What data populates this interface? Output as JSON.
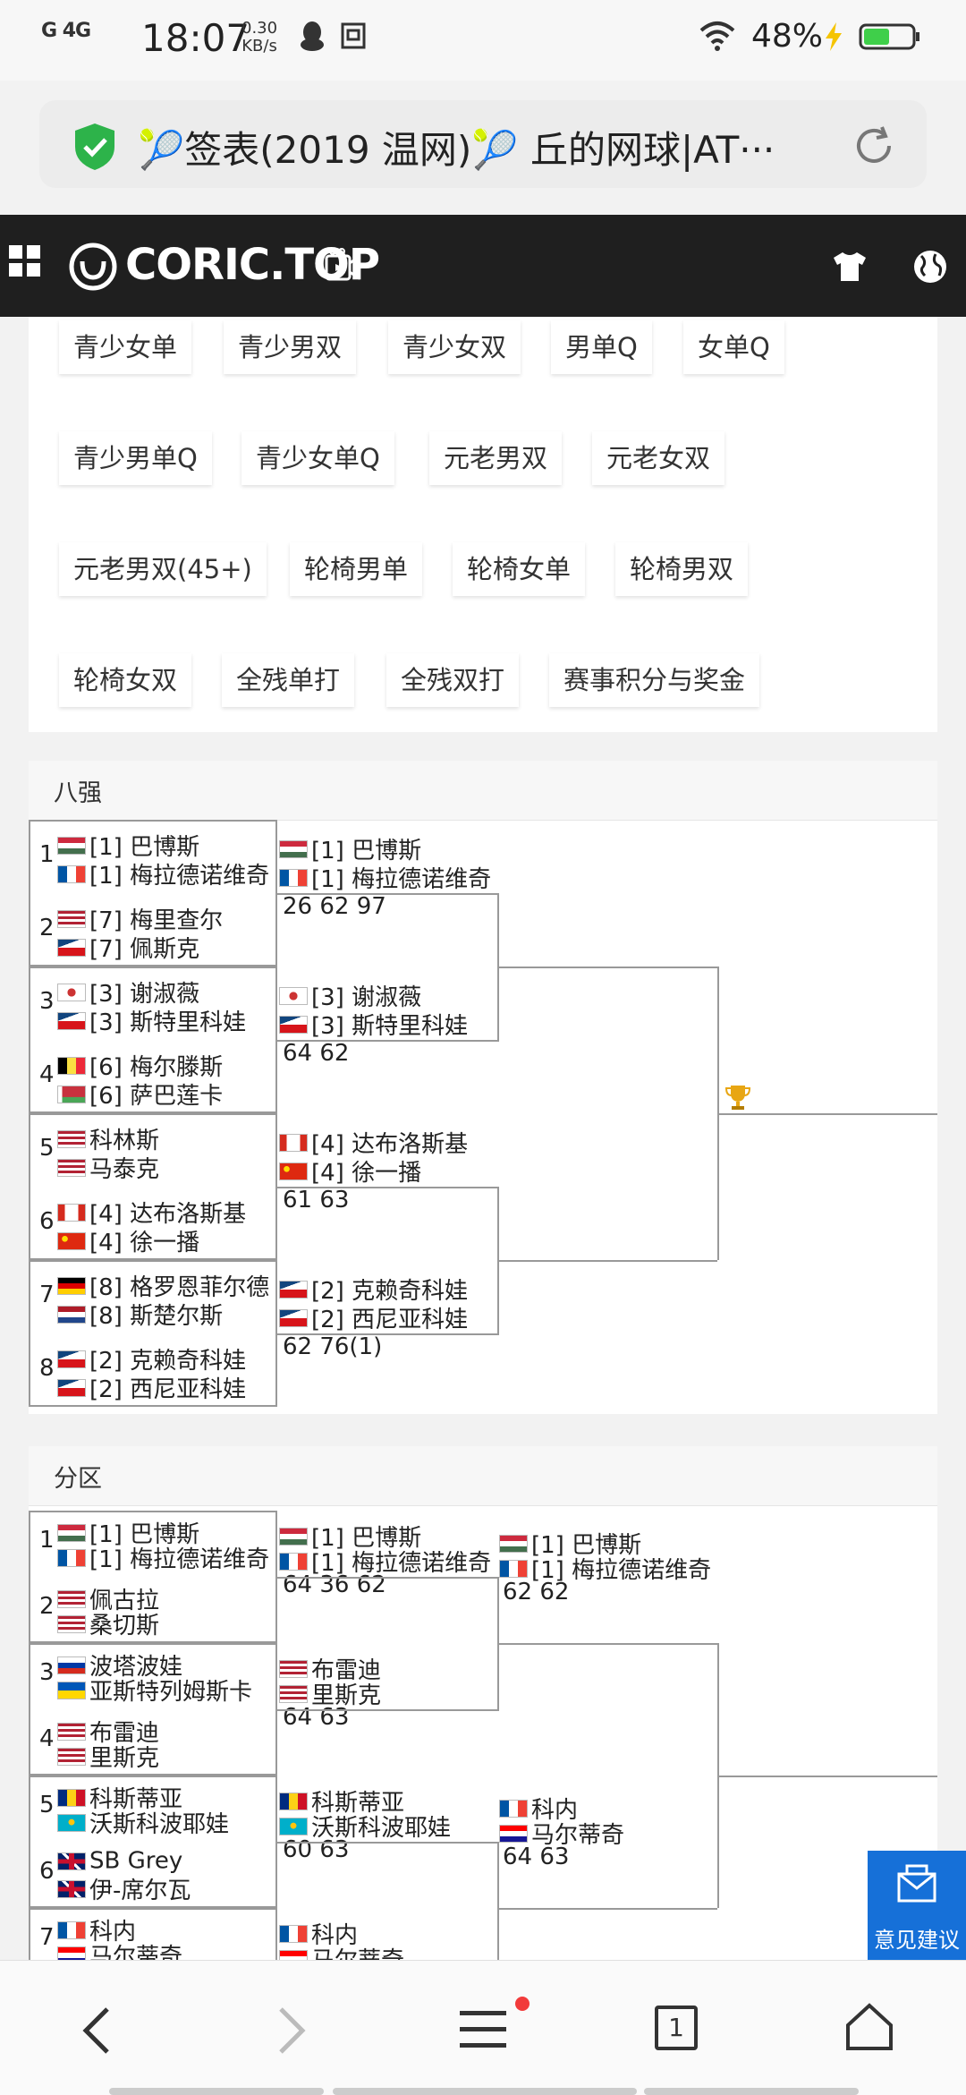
{
  "status_bar": {
    "signal": "G 4G",
    "time": "18:07",
    "speed_value": "0.30",
    "speed_unit": "KB/s",
    "battery": "48%"
  },
  "url_bar": {
    "title": "🎾签表(2019 温网)🎾 丘的网球|AT···"
  },
  "site_header": {
    "logo_text": "CORIC.TOP"
  },
  "categories": [
    "青少女单",
    "青少男双",
    "青少女双",
    "男单Q",
    "女单Q",
    "青少男单Q",
    "青少女单Q",
    "元老男双",
    "元老女双",
    "元老男双(45+)",
    "轮椅男单",
    "轮椅女单",
    "轮椅男双",
    "轮椅女双",
    "全残单打",
    "全残双打",
    "赛事积分与奖金"
  ],
  "quarterfinals": {
    "title": "八强",
    "entries": [
      {
        "num": "1",
        "p1": {
          "flag": "hu",
          "name": "[1] 巴博斯"
        },
        "p2": {
          "flag": "fr",
          "name": "[1] 梅拉德诺维奇"
        }
      },
      {
        "num": "2",
        "p1": {
          "flag": "us",
          "name": "[7] 梅里查尔"
        },
        "p2": {
          "flag": "cz",
          "name": "[7] 佩斯克"
        }
      },
      {
        "num": "3",
        "p1": {
          "flag": "tw",
          "name": "[3] 谢淑薇"
        },
        "p2": {
          "flag": "cz",
          "name": "[3] 斯特里科娃"
        }
      },
      {
        "num": "4",
        "p1": {
          "flag": "be",
          "name": "[6] 梅尔滕斯"
        },
        "p2": {
          "flag": "by",
          "name": "[6] 萨巴莲卡"
        }
      },
      {
        "num": "5",
        "p1": {
          "flag": "us",
          "name": "科林斯"
        },
        "p2": {
          "flag": "us",
          "name": "马泰克"
        }
      },
      {
        "num": "6",
        "p1": {
          "flag": "ca",
          "name": "[4] 达布洛斯基"
        },
        "p2": {
          "flag": "cn",
          "name": "[4] 徐一播"
        }
      },
      {
        "num": "7",
        "p1": {
          "flag": "de",
          "name": "[8] 格罗恩菲尔德"
        },
        "p2": {
          "flag": "nl",
          "name": "[8] 斯楚尔斯"
        }
      },
      {
        "num": "8",
        "p1": {
          "flag": "cz",
          "name": "[2] 克赖奇科娃"
        },
        "p2": {
          "flag": "cz",
          "name": "[2] 西尼亚科娃"
        }
      }
    ],
    "semis": [
      {
        "p1": {
          "flag": "hu",
          "name": "[1] 巴博斯"
        },
        "p2": {
          "flag": "fr",
          "name": "[1] 梅拉德诺维奇"
        },
        "score": "26 62 97"
      },
      {
        "p1": {
          "flag": "tw",
          "name": "[3] 谢淑薇"
        },
        "p2": {
          "flag": "cz",
          "name": "[3] 斯特里科娃"
        },
        "score": "64 62"
      },
      {
        "p1": {
          "flag": "ca",
          "name": "[4] 达布洛斯基"
        },
        "p2": {
          "flag": "cn",
          "name": "[4] 徐一播"
        },
        "score": "61 63"
      },
      {
        "p1": {
          "flag": "cz",
          "name": "[2] 克赖奇科娃"
        },
        "p2": {
          "flag": "cz",
          "name": "[2] 西尼亚科娃"
        },
        "score": "62 76(1)"
      }
    ]
  },
  "sections": {
    "title": "分区",
    "entries": [
      {
        "num": "1",
        "p1": {
          "flag": "hu",
          "name": "[1] 巴博斯"
        },
        "p2": {
          "flag": "fr",
          "name": "[1] 梅拉德诺维奇"
        }
      },
      {
        "num": "2",
        "p1": {
          "flag": "us",
          "name": "佩古拉"
        },
        "p2": {
          "flag": "us",
          "name": "桑切斯"
        }
      },
      {
        "num": "3",
        "p1": {
          "flag": "ru",
          "name": "波塔波娃"
        },
        "p2": {
          "flag": "ua",
          "name": "亚斯特列姆斯卡"
        }
      },
      {
        "num": "4",
        "p1": {
          "flag": "us",
          "name": "布雷迪"
        },
        "p2": {
          "flag": "us",
          "name": "里斯克"
        }
      },
      {
        "num": "5",
        "p1": {
          "flag": "ro",
          "name": "科斯蒂亚"
        },
        "p2": {
          "flag": "kz",
          "name": "沃斯科波耶娃"
        }
      },
      {
        "num": "6",
        "p1": {
          "flag": "gb",
          "name": "SB Grey"
        },
        "p2": {
          "flag": "gb",
          "name": "伊-席尔瓦"
        }
      },
      {
        "num": "7",
        "p1": {
          "flag": "fr",
          "name": "科内"
        },
        "p2": {
          "flag": "hr",
          "name": "马尔蒂奇"
        }
      }
    ],
    "r2": [
      {
        "p1": {
          "flag": "hu",
          "name": "[1] 巴博斯"
        },
        "p2": {
          "flag": "fr",
          "name": "[1] 梅拉德诺维奇"
        },
        "score": "64 36 62"
      },
      {
        "p1": {
          "flag": "us",
          "name": "布雷迪"
        },
        "p2": {
          "flag": "us",
          "name": "里斯克"
        },
        "score": "64 63"
      },
      {
        "p1": {
          "flag": "ro",
          "name": "科斯蒂亚"
        },
        "p2": {
          "flag": "kz",
          "name": "沃斯科波耶娃"
        },
        "score": "60 63"
      },
      {
        "p1": {
          "flag": "fr",
          "name": "科内"
        },
        "p2": {
          "flag": "hr",
          "name": "马尔蒂奇"
        },
        "score": ""
      }
    ],
    "r3": [
      {
        "p1": {
          "flag": "hu",
          "name": "[1] 巴博斯"
        },
        "p2": {
          "flag": "fr",
          "name": "[1] 梅拉德诺维奇"
        },
        "score": "62 62"
      },
      {
        "p1": {
          "flag": "fr",
          "name": "科内"
        },
        "p2": {
          "flag": "hr",
          "name": "马尔蒂奇"
        },
        "score": "64 63"
      }
    ]
  },
  "feedback": {
    "label": "意见建议"
  },
  "bottom_nav": {
    "tabs_count": "1"
  },
  "colors": {
    "header_bg": "#1f1f1f",
    "feedback_bg": "#1670d8",
    "bracket_line": "#999999",
    "shield_green": "#2db34a"
  }
}
